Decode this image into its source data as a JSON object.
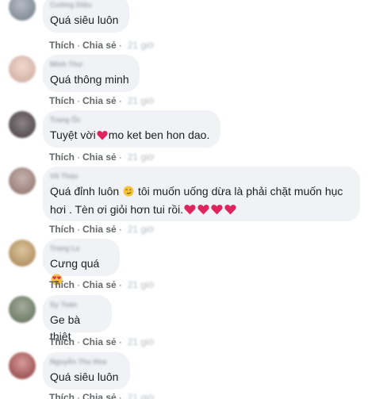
{
  "comments": [
    {
      "author": "Cường Diệu",
      "text": "Quá siêu luôn",
      "like_label": "Thích",
      "reply_label": "Chia sẻ",
      "time": "21 giờ",
      "avatar_colors": [
        "#6f7a86",
        "#b7bcc4"
      ]
    },
    {
      "author": "Minh Thư",
      "text": "Quá thông minh",
      "like_label": "Thích",
      "reply_label": "Chia sẻ",
      "time": "21 giờ",
      "avatar_colors": [
        "#c9a79a",
        "#f1d8cf"
      ]
    },
    {
      "author": "Trang Ốc",
      "text_before": "Tuyệt vời",
      "emoji": "heart",
      "text_after": "mo ket ben hon dao.",
      "like_label": "Thích",
      "reply_label": "Chia sẻ",
      "time": "21 giờ",
      "avatar_colors": [
        "#3f3a3d",
        "#8f8488"
      ]
    },
    {
      "author": "Võ Thảo",
      "line1_before": "Quá đỉnh luôn ",
      "line1_emoji": "smirk",
      "line1_after": " tôi muốn uống dừa là phải chặt muốn hục",
      "line2": "hơi . Tèn ơi giỏi hơn tui rồi.",
      "hearts": 4,
      "like_label": "Thích",
      "reply_label": "Chia sẻ",
      "time": "21 giờ",
      "avatar_colors": [
        "#8c6f6a",
        "#c7b2ad"
      ]
    },
    {
      "author": "Trang Le",
      "text": "Cưng quá",
      "emoji": "heart-eyes",
      "like_label": "Thích",
      "reply_label": "Chia sẻ",
      "time": "21 giờ",
      "avatar_colors": [
        "#a4804e",
        "#dcc59e"
      ]
    },
    {
      "author": "Sy Toàn",
      "text": "Ge bà thiệt",
      "like_label": "Thích",
      "reply_label": "Chia sẻ",
      "time": "21 giờ",
      "avatar_colors": [
        "#5f6b58",
        "#a3ad9a"
      ]
    },
    {
      "author": "Nguyễn Thu Hoa",
      "text": "Quá siêu luôn",
      "like_label": "Thích",
      "reply_label": "Chia sẻ",
      "time": "21 giờ",
      "avatar_colors": [
        "#8a3b3b",
        "#d69b98"
      ]
    }
  ],
  "colors": {
    "bubble": "#f0f2f5",
    "text": "#1c1e21",
    "action": "#65676b",
    "heart": "#e0245e"
  }
}
